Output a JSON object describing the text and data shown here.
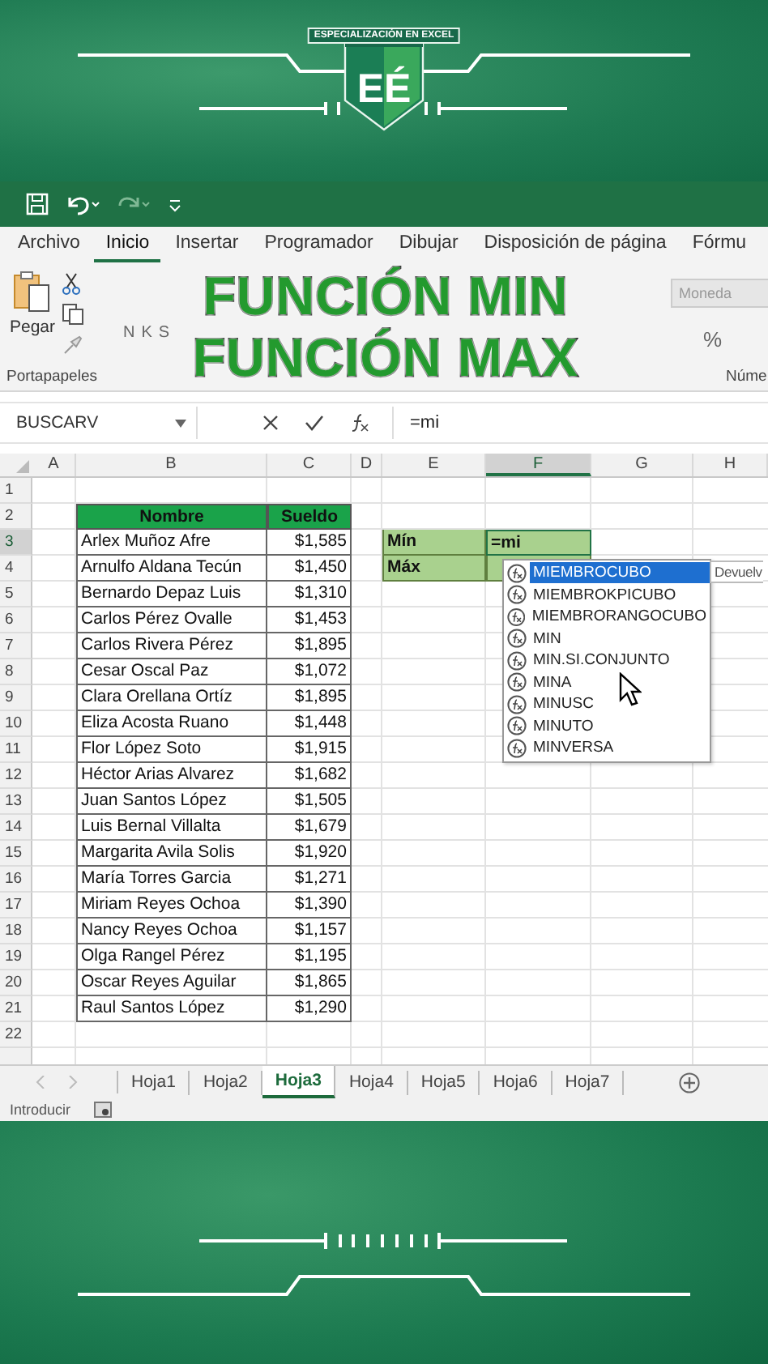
{
  "logo": {
    "caption": "ESPECIALIZACIÓN EN EXCEL",
    "letters": "EÉ"
  },
  "ribbon_tabs": [
    {
      "label": "Archivo",
      "selected": false
    },
    {
      "label": "Inicio",
      "selected": true
    },
    {
      "label": "Insertar",
      "selected": false
    },
    {
      "label": "Programador",
      "selected": false
    },
    {
      "label": "Dibujar",
      "selected": false
    },
    {
      "label": "Disposición de página",
      "selected": false
    },
    {
      "label": "Fórmu",
      "selected": false
    }
  ],
  "ribbon": {
    "paste_label": "Pegar",
    "clipboard_group": "Portapapeles",
    "font_buttons": [
      "N",
      "K",
      "S"
    ],
    "number_format": "Moneda",
    "percent": "%",
    "number_group": "Núme"
  },
  "title_overlay": [
    "FUNCIÓN MIN",
    "FUNCIÓN MAX"
  ],
  "formula_bar": {
    "name_box": "BUSCARV",
    "formula": "=mi"
  },
  "column_headers": [
    {
      "label": "A",
      "selected": false
    },
    {
      "label": "B",
      "selected": false
    },
    {
      "label": "C",
      "selected": false
    },
    {
      "label": "D",
      "selected": false
    },
    {
      "label": "E",
      "selected": false
    },
    {
      "label": "F",
      "selected": true
    },
    {
      "label": "G",
      "selected": false
    },
    {
      "label": "H",
      "selected": false
    }
  ],
  "row_headers": [
    {
      "label": "1",
      "selected": false
    },
    {
      "label": "2",
      "selected": false
    },
    {
      "label": "3",
      "selected": true
    },
    {
      "label": "4",
      "selected": false
    },
    {
      "label": "5",
      "selected": false
    },
    {
      "label": "6",
      "selected": false
    },
    {
      "label": "7",
      "selected": false
    },
    {
      "label": "8",
      "selected": false
    },
    {
      "label": "9",
      "selected": false
    },
    {
      "label": "10",
      "selected": false
    },
    {
      "label": "11",
      "selected": false
    },
    {
      "label": "12",
      "selected": false
    },
    {
      "label": "13",
      "selected": false
    },
    {
      "label": "14",
      "selected": false
    },
    {
      "label": "15",
      "selected": false
    },
    {
      "label": "16",
      "selected": false
    },
    {
      "label": "17",
      "selected": false
    },
    {
      "label": "18",
      "selected": false
    },
    {
      "label": "19",
      "selected": false
    },
    {
      "label": "20",
      "selected": false
    },
    {
      "label": "21",
      "selected": false
    },
    {
      "label": "22",
      "selected": false
    }
  ],
  "table": {
    "columns": [
      "Nombre",
      "Sueldo"
    ],
    "rows": [
      [
        "Arlex Muñoz Afre",
        "$1,585"
      ],
      [
        "Arnulfo Aldana Tecún",
        "$1,450"
      ],
      [
        "Bernardo Depaz Luis",
        "$1,310"
      ],
      [
        "Carlos Pérez Ovalle",
        "$1,453"
      ],
      [
        "Carlos Rivera Pérez",
        "$1,895"
      ],
      [
        "Cesar Oscal Paz",
        "$1,072"
      ],
      [
        "Clara Orellana Ortíz",
        "$1,895"
      ],
      [
        "Eliza Acosta Ruano",
        "$1,448"
      ],
      [
        "Flor  López Soto",
        "$1,915"
      ],
      [
        "Héctor Arias Alvarez",
        "$1,682"
      ],
      [
        "Juan Santos López",
        "$1,505"
      ],
      [
        "Luis Bernal Villalta",
        "$1,679"
      ],
      [
        "Margarita Avila Solis",
        "$1,920"
      ],
      [
        "María Torres Garcia",
        "$1,271"
      ],
      [
        "Miriam Reyes Ochoa",
        "$1,390"
      ],
      [
        "Nancy Reyes Ochoa",
        "$1,157"
      ],
      [
        "Olga Rangel Pérez",
        "$1,195"
      ],
      [
        "Oscar Reyes Aguilar",
        "$1,865"
      ],
      [
        "Raul Santos López",
        "$1,290"
      ]
    ]
  },
  "summary": [
    {
      "label": "Mín",
      "value": "=mi"
    },
    {
      "label": "Máx"
    }
  ],
  "autocomplete": {
    "items": [
      {
        "label": "MIEMBROCUBO",
        "selected": true
      },
      {
        "label": "MIEMBROKPICUBO",
        "selected": false
      },
      {
        "label": "MIEMBRORANGOCUBO",
        "selected": false
      },
      {
        "label": "MIN",
        "selected": false
      },
      {
        "label": "MIN.SI.CONJUNTO",
        "selected": false
      },
      {
        "label": "MINA",
        "selected": false
      },
      {
        "label": "MINUSC",
        "selected": false
      },
      {
        "label": "MINUTO",
        "selected": false
      },
      {
        "label": "MINVERSA",
        "selected": false
      }
    ],
    "tooltip": "Devuelv"
  },
  "sheet_tabs": [
    {
      "label": "Hoja1",
      "selected": false
    },
    {
      "label": "Hoja2",
      "selected": false
    },
    {
      "label": "Hoja3",
      "selected": true
    },
    {
      "label": "Hoja4",
      "selected": false
    },
    {
      "label": "Hoja5",
      "selected": false
    },
    {
      "label": "Hoja6",
      "selected": false
    },
    {
      "label": "Hoja7",
      "selected": false
    }
  ],
  "status_bar": {
    "mode": "Introducir"
  }
}
